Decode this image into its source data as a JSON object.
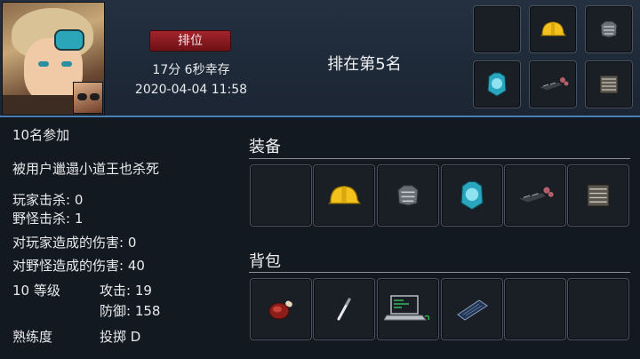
{
  "header": {
    "rank_badge": "排位",
    "survival_time": "17分 6秒幸存",
    "timestamp": "2020-04-04 11:58",
    "rank_text": "排在第5名"
  },
  "stats": {
    "participants": "10名参加",
    "killed_by": "被用户邋遢小道王也杀死",
    "player_kills": "玩家击杀: 0",
    "monster_kills": "野怪击杀: 1",
    "damage_to_players": "对玩家造成的伤害: 0",
    "damage_to_monsters": "对野怪造成的伤害: 40",
    "level": "10 等级",
    "attack": "攻击: 19",
    "defense": "防御: 158",
    "proficiency_label": "熟练度",
    "proficiency_value": "投掷 D"
  },
  "sections": {
    "equipment_title": "装备",
    "backpack_title": "背包"
  },
  "header_slots": [
    "empty-slot",
    "helmet-icon",
    "armor-icon",
    "chest-armor-icon",
    "weapon-icon",
    "shoes-icon"
  ],
  "equipment_slots": [
    "empty-slot",
    "helmet-icon",
    "armor-icon",
    "chest-armor-icon",
    "weapon-icon",
    "shoes-icon"
  ],
  "backpack_slots": [
    "meat-icon",
    "stick-icon",
    "laptop-icon",
    "tablet-icon",
    "empty-slot",
    "empty-slot"
  ]
}
